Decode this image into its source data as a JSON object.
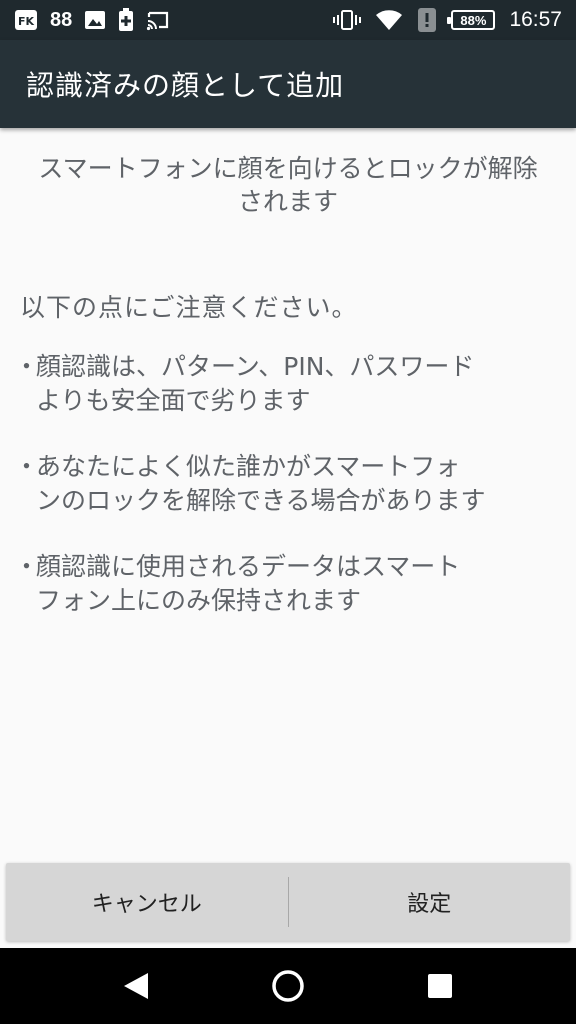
{
  "status_bar": {
    "notification_count": "88",
    "battery_level": "88%",
    "time": "16:57"
  },
  "app_bar": {
    "title": "認識済みの顔として追加"
  },
  "content": {
    "intro_line1": "スマートフォンに顔を向けるとロックが解除",
    "intro_line2": "されます",
    "notice_heading": "以下の点にご注意ください。",
    "bullet_symbol": "・",
    "bullets": [
      {
        "line1": "顔認識は、パターン、PIN、パスワード",
        "line2": "よりも安全面で劣ります"
      },
      {
        "line1": "あなたによく似た誰かがスマートフォ",
        "line2": "ンのロックを解除できる場合があります"
      },
      {
        "line1": "顔認識に使用されるデータはスマート",
        "line2": "フォン上にのみ保持されます"
      }
    ]
  },
  "buttons": {
    "cancel_label": "キャンセル",
    "setup_label": "設定"
  },
  "colors": {
    "status_bar_bg": "#1f292e",
    "app_bar_bg": "#263238",
    "page_bg": "#fafafa",
    "body_text": "#5f6368",
    "button_bar_bg": "#d6d6d6",
    "nav_bar_bg": "#000000"
  },
  "icons": {
    "status_left": [
      "app-fk-icon",
      "image-icon",
      "battery-saver-icon",
      "cast-icon"
    ],
    "status_right": [
      "vibrate-icon",
      "wifi-icon",
      "alert-icon",
      "battery-icon"
    ],
    "nav": [
      "back-icon",
      "home-icon",
      "recents-icon"
    ]
  }
}
